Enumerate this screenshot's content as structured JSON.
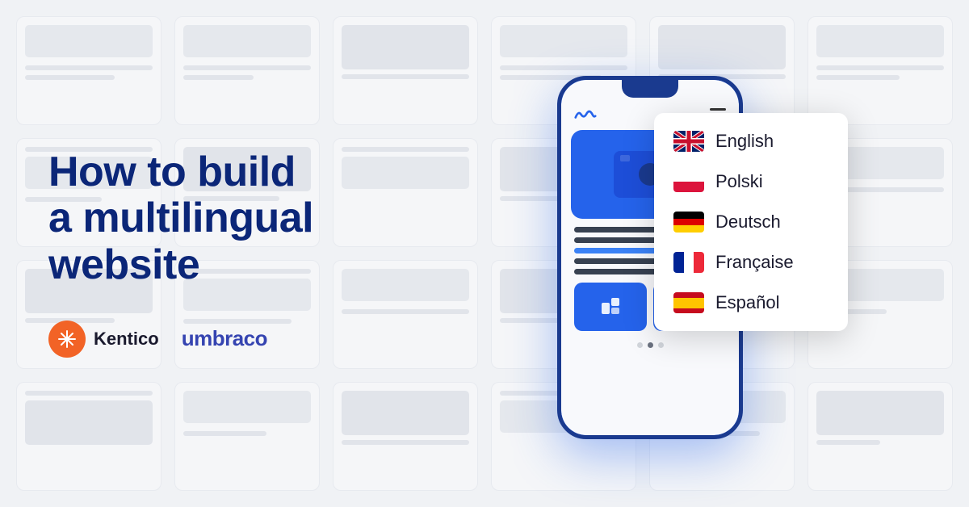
{
  "page": {
    "background_color": "#f0f2f5"
  },
  "headline": {
    "line1": "How to build",
    "line2": "a multilingual",
    "line3": "website"
  },
  "logos": {
    "kentico": {
      "name": "Kentico",
      "icon_color": "#f26326"
    },
    "umbraco": {
      "name": "umbraco",
      "color": "#3544b1"
    }
  },
  "phone": {
    "nav_hamburger": "≡"
  },
  "languages": [
    {
      "id": "en",
      "flag": "uk",
      "name": "English"
    },
    {
      "id": "pl",
      "flag": "pl",
      "name": "Polski"
    },
    {
      "id": "de",
      "flag": "de",
      "name": "Deutsch"
    },
    {
      "id": "fr",
      "flag": "fr",
      "name": "Française"
    },
    {
      "id": "es",
      "flag": "es",
      "name": "Español"
    }
  ]
}
